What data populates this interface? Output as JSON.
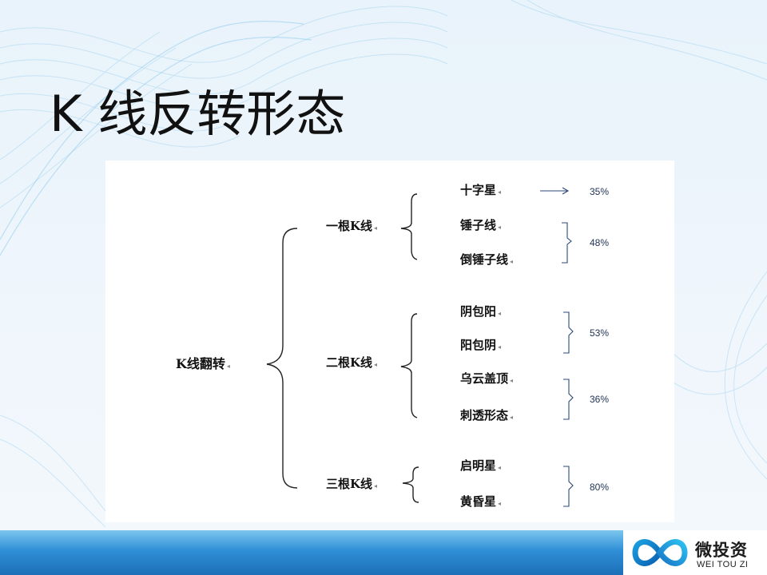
{
  "slide": {
    "title": "K 线反转形态"
  },
  "diagram": {
    "root": {
      "label": "K线翻转",
      "mark": "◂"
    },
    "groups": [
      {
        "label": "一根K线",
        "mark": "◂"
      },
      {
        "label": "二根K线",
        "mark": "◂"
      },
      {
        "label": "三根K线",
        "mark": "◂"
      }
    ],
    "patterns": [
      {
        "label": "十字星",
        "mark": "◂"
      },
      {
        "label": "锤子线",
        "mark": "◂"
      },
      {
        "label": "倒锤子线",
        "mark": "◂"
      },
      {
        "label": "阴包阳",
        "mark": "◂"
      },
      {
        "label": "阳包阴",
        "mark": "◂"
      },
      {
        "label": "乌云盖顶",
        "mark": "◂"
      },
      {
        "label": "刺透形态",
        "mark": "◂"
      },
      {
        "label": "启明星",
        "mark": "◂"
      },
      {
        "label": "黄昏星",
        "mark": "◂"
      }
    ],
    "percentages": [
      "35%",
      "48%",
      "53%",
      "36%",
      "80%"
    ]
  },
  "footer": {
    "logo_name": "微投资",
    "logo_sub": "WEI TOU ZI"
  },
  "colors": {
    "footer_bar": "#2f8fd6",
    "bracket_stroke": "#222222",
    "annotation_stroke": "#2b4a7a"
  }
}
